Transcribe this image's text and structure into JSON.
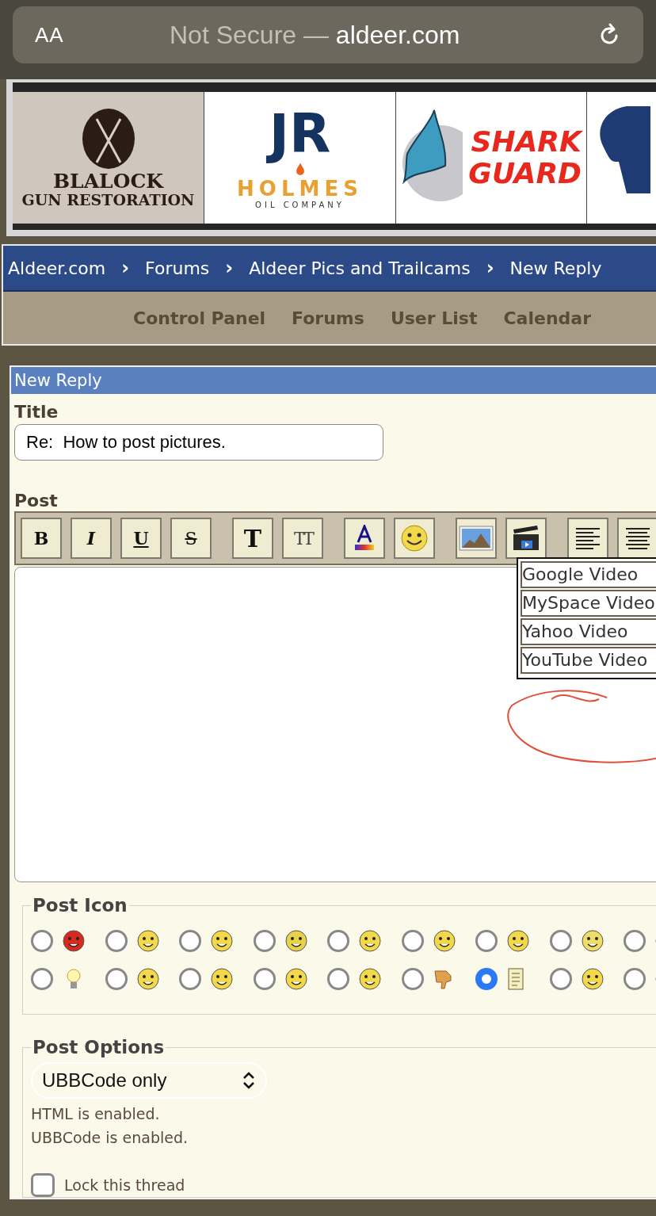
{
  "browser_bar": {
    "text_size_button": "AA",
    "security_label": "Not Secure —",
    "domain": "aldeer.com"
  },
  "ads": [
    {
      "kind": "crest",
      "lines": [
        "BLALOCK",
        "GUN RESTORATION"
      ]
    },
    {
      "kind": "oil",
      "lines": [
        "JR",
        "HOLMES",
        "OIL COMPANY"
      ]
    },
    {
      "kind": "shark",
      "lines": [
        "SHARK",
        "GUARD"
      ]
    },
    {
      "kind": "tree"
    }
  ],
  "breadcrumb": [
    "Aldeer.com",
    "Forums",
    "Aldeer Pics and Trailcams",
    "New Reply"
  ],
  "breadcrumb_separator": "›",
  "nav": [
    "Control Panel",
    "Forums",
    "User List",
    "Calendar"
  ],
  "panel": {
    "title": "New Reply"
  },
  "title_field": {
    "label": "Title",
    "value": "Re:  How to post pictures."
  },
  "post": {
    "label": "Post"
  },
  "toolbar": [
    [
      {
        "kind": "bold",
        "label": "B"
      },
      {
        "kind": "italic",
        "label": "I"
      },
      {
        "kind": "underline",
        "label": "U"
      },
      {
        "kind": "strike",
        "label": "S"
      }
    ],
    [
      {
        "kind": "heavy",
        "label": "T"
      },
      {
        "kind": "size",
        "label": "TT"
      }
    ],
    [
      {
        "kind": "icon"
      },
      {
        "kind": "icon"
      }
    ],
    [
      {
        "kind": "icon"
      },
      {
        "kind": "icon"
      }
    ],
    [
      {
        "kind": "icon"
      },
      {
        "kind": "icon"
      }
    ]
  ],
  "video_menu": [
    "Google Video",
    "MySpace Video",
    "Yahoo Video",
    "YouTube Video"
  ],
  "post_icon": {
    "legend": "Post Icon",
    "rows": [
      [
        {
          "selected": false
        },
        {
          "selected": false
        },
        {
          "selected": false
        },
        {
          "selected": false
        },
        {
          "selected": false
        },
        {
          "selected": false
        },
        {
          "selected": false
        },
        {
          "selected": false
        },
        {
          "selected": false
        }
      ],
      [
        {
          "selected": false
        },
        {
          "selected": false
        },
        {
          "selected": false
        },
        {
          "selected": false
        },
        {
          "selected": false
        },
        {
          "selected": false
        },
        {
          "selected": true
        },
        {
          "selected": false
        },
        {
          "selected": false
        }
      ]
    ]
  },
  "post_options": {
    "legend": "Post Options",
    "markup_select": "UBBCode only",
    "notes": [
      "HTML is enabled.",
      "UBBCode is enabled."
    ],
    "lock_thread": {
      "label": "Lock this thread",
      "checked": false
    }
  }
}
